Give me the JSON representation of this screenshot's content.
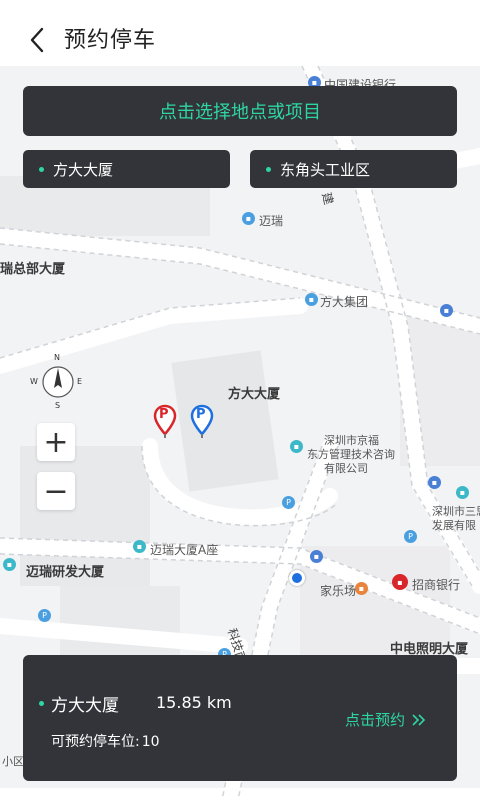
{
  "header": {
    "title": "预约停车"
  },
  "search": {
    "prompt": "点击选择地点或项目"
  },
  "chips": [
    {
      "label": "方大大厦"
    },
    {
      "label": "东角头工业区"
    }
  ],
  "map": {
    "labels": {
      "bank_top": "中国建设银行",
      "maireui": "迈瑞",
      "ruizongbu": "瑞总部大厦",
      "fangda_group": "方大集团",
      "fangda_building": "方大大厦",
      "jingfu_1": "深圳市京福",
      "jingfu_2": "东方管理技术咨询",
      "jingfu_3": "有限公司",
      "mairui_a": "迈瑞大厦A座",
      "mairui_rd": "迈瑞研发大厦",
      "jialechang": "家乐场",
      "cmb": "招商银行",
      "sansi_1": "深圳市三思",
      "sansi_2": "发展有限",
      "zhongdian": "中电照明大厦",
      "road_kejinan": "科技南十二路",
      "xiaokou": "小区",
      "jian": "建"
    },
    "compass": {
      "n": "N",
      "s": "S",
      "e": "E",
      "w": "W"
    },
    "zoom_in": "+",
    "zoom_out": "−",
    "pin_letter": "P",
    "colors": {
      "pin_red": "#d8262a",
      "pin_blue": "#1e6fe0",
      "accent": "#2ed6a3",
      "panel": "#33343a"
    }
  },
  "info_card": {
    "place": "方大大厦",
    "distance": "15.85 km",
    "spaces_label": "可预约停车位:",
    "spaces_count": "10",
    "reserve_label": "点击预约"
  }
}
